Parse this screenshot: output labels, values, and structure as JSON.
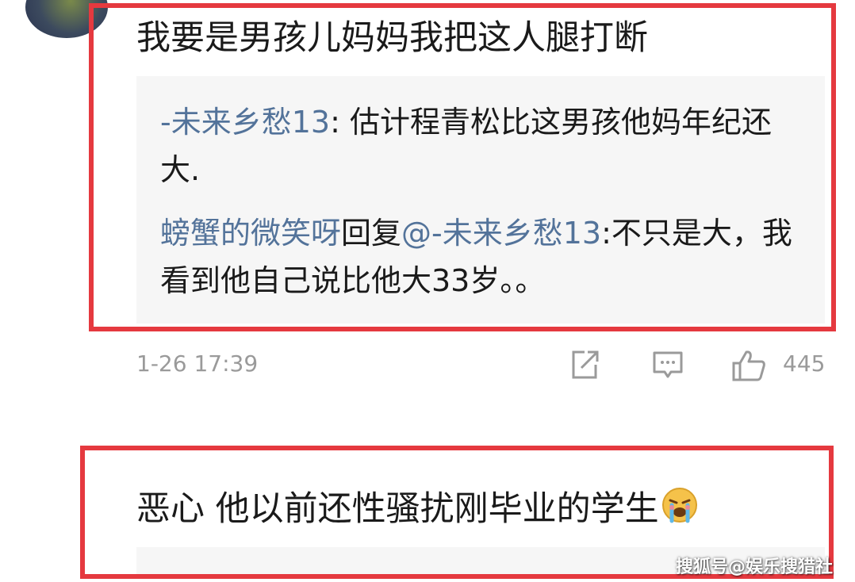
{
  "comment1": {
    "text": "我要是男孩儿妈妈我把这人腿打断"
  },
  "replies": [
    {
      "username": "-未来乡愁13",
      "separator": ": ",
      "text": "估计程青松比这男孩他妈年纪还大."
    },
    {
      "username": "螃蟹的微笑呀",
      "reply_word": "回复",
      "mention": "@-未来乡愁13",
      "separator": ":",
      "text": "不只是大，我看到他自己说比他大33岁。。"
    }
  ],
  "meta": {
    "timestamp": "1-26 17:39",
    "like_count": "445",
    "icons": [
      "share-icon",
      "comment-icon",
      "thumbs-up-icon"
    ]
  },
  "comment2": {
    "text": "恶心 他以前还性骚扰刚毕业的学生",
    "emoji": "crying-face-emoji"
  },
  "watermark": {
    "text": "搜狐号@娱乐搜猎社"
  },
  "colors": {
    "highlight": "#e5393f",
    "username": "#53739a",
    "meta": "#9a9a9a",
    "reply_bg": "#f6f6f6"
  }
}
